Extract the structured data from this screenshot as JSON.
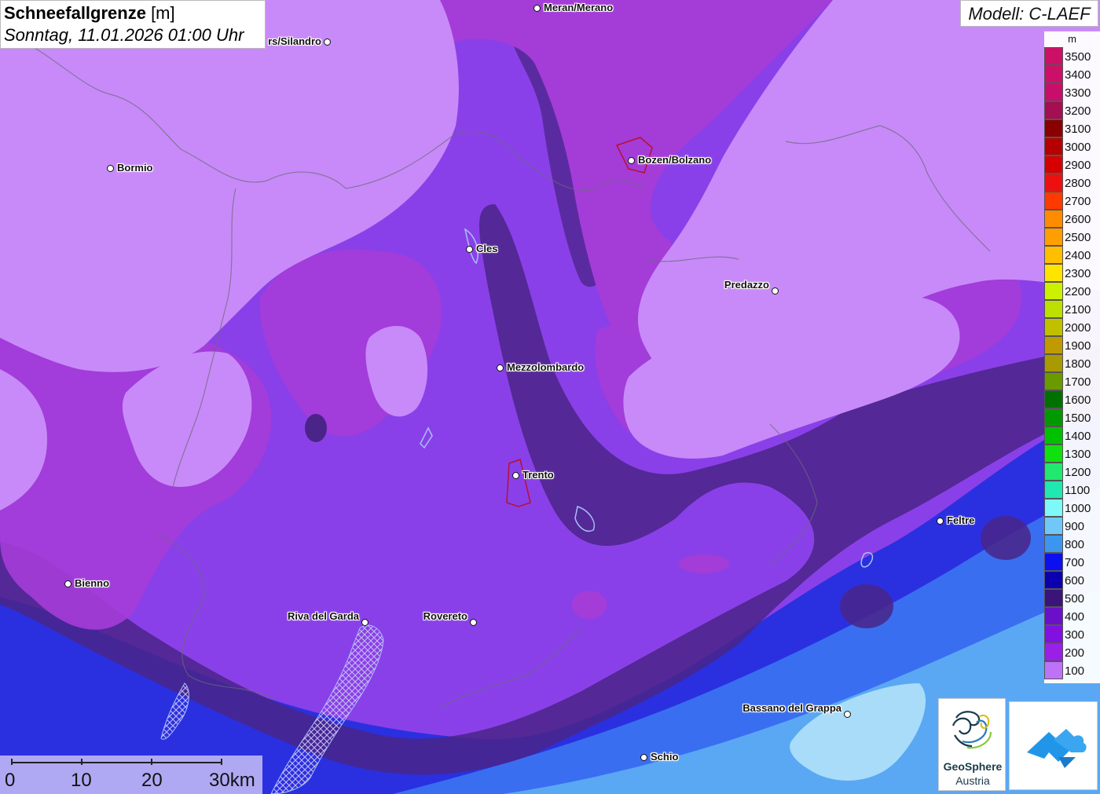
{
  "title": {
    "bold": "Schneefallgrenze",
    "unit": " [m]",
    "subtitle": "Sonntag, 11.01.2026 01:00 Uhr"
  },
  "model": "Modell: C-LAEF",
  "legend": {
    "unit": "m",
    "items": [
      {
        "label": "3500",
        "color": "#cc1066"
      },
      {
        "label": "3400",
        "color": "#cc1068"
      },
      {
        "label": "3300",
        "color": "#c80e6a"
      },
      {
        "label": "3200",
        "color": "#a40e52"
      },
      {
        "label": "3100",
        "color": "#8a0000"
      },
      {
        "label": "3000",
        "color": "#b40000"
      },
      {
        "label": "2900",
        "color": "#d60000"
      },
      {
        "label": "2800",
        "color": "#ee1010"
      },
      {
        "label": "2700",
        "color": "#ff3a00"
      },
      {
        "label": "2600",
        "color": "#ff8c00"
      },
      {
        "label": "2500",
        "color": "#ff9e00"
      },
      {
        "label": "2400",
        "color": "#ffbe00"
      },
      {
        "label": "2300",
        "color": "#ffe400"
      },
      {
        "label": "2200",
        "color": "#ccf000"
      },
      {
        "label": "2100",
        "color": "#bce000"
      },
      {
        "label": "2000",
        "color": "#c0c000"
      },
      {
        "label": "1900",
        "color": "#c09a00"
      },
      {
        "label": "1800",
        "color": "#a89a00"
      },
      {
        "label": "1700",
        "color": "#6a9a00"
      },
      {
        "label": "1600",
        "color": "#007000"
      },
      {
        "label": "1500",
        "color": "#009a00"
      },
      {
        "label": "1400",
        "color": "#00c000"
      },
      {
        "label": "1300",
        "color": "#10e010"
      },
      {
        "label": "1200",
        "color": "#20e870"
      },
      {
        "label": "1100",
        "color": "#20e8b0"
      },
      {
        "label": "1000",
        "color": "#7ef8f8"
      },
      {
        "label": "900",
        "color": "#70c8f8"
      },
      {
        "label": "800",
        "color": "#3c96f0"
      },
      {
        "label": "700",
        "color": "#0c10f0"
      },
      {
        "label": "600",
        "color": "#0a00b0"
      },
      {
        "label": "500",
        "color": "#3a1478"
      },
      {
        "label": "400",
        "color": "#6a10c8"
      },
      {
        "label": "300",
        "color": "#8210e0"
      },
      {
        "label": "200",
        "color": "#9a20e8"
      },
      {
        "label": "100",
        "color": "#be72f8"
      }
    ]
  },
  "cities": [
    {
      "name": "Meran/Merano",
      "labelSide": "right"
    },
    {
      "name": "rs/Silandro",
      "labelSide": "left"
    },
    {
      "name": "Bormio",
      "labelSide": "right"
    },
    {
      "name": "Bozen/Bolzano",
      "labelSide": "right"
    },
    {
      "name": "Cles",
      "labelSide": "right"
    },
    {
      "name": "Predazzo",
      "labelSide": "left"
    },
    {
      "name": "Mezzolombardo",
      "labelSide": "right"
    },
    {
      "name": "Trento",
      "labelSide": "right"
    },
    {
      "name": "Feltre",
      "labelSide": "right"
    },
    {
      "name": "Bienno",
      "labelSide": "right"
    },
    {
      "name": "Riva del Garda",
      "labelSide": "left"
    },
    {
      "name": "Rovereto",
      "labelSide": "left"
    },
    {
      "name": "Bassano del Grappa",
      "labelSide": "left"
    },
    {
      "name": "Schio",
      "labelSide": "right"
    }
  ],
  "scale": {
    "labels": [
      "0",
      "10",
      "20",
      "30km"
    ]
  },
  "logo": {
    "line1": "GeoSphere",
    "line2": "Austria"
  },
  "icons": {
    "logo": "geosphere-logo-icon",
    "app": "app-cloud-icon"
  }
}
